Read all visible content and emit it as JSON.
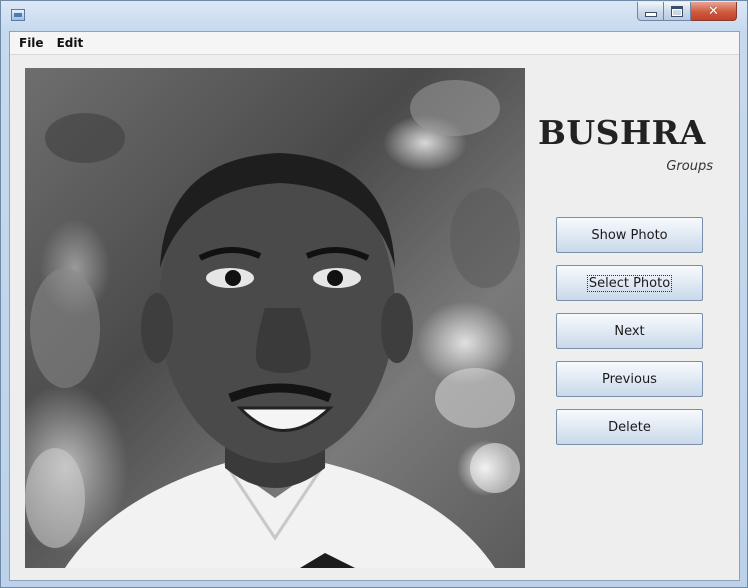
{
  "window": {
    "title": "",
    "controls": {
      "minimize": "minimize-icon",
      "maximize": "maximize-icon",
      "close": "close-icon"
    }
  },
  "menubar": {
    "items": [
      {
        "label": "File"
      },
      {
        "label": "Edit"
      }
    ]
  },
  "main": {
    "photo": {
      "description_icon": "portrait-photo"
    },
    "title": "BUSHRA",
    "subtitle": "Groups",
    "buttons": [
      {
        "label": "Show Photo"
      },
      {
        "label": "Select Photo"
      },
      {
        "label": "Next"
      },
      {
        "label": "Previous"
      },
      {
        "label": "Delete"
      }
    ]
  },
  "colors": {
    "button_border": "#7a8fa8",
    "close_button": "#c9503a"
  }
}
